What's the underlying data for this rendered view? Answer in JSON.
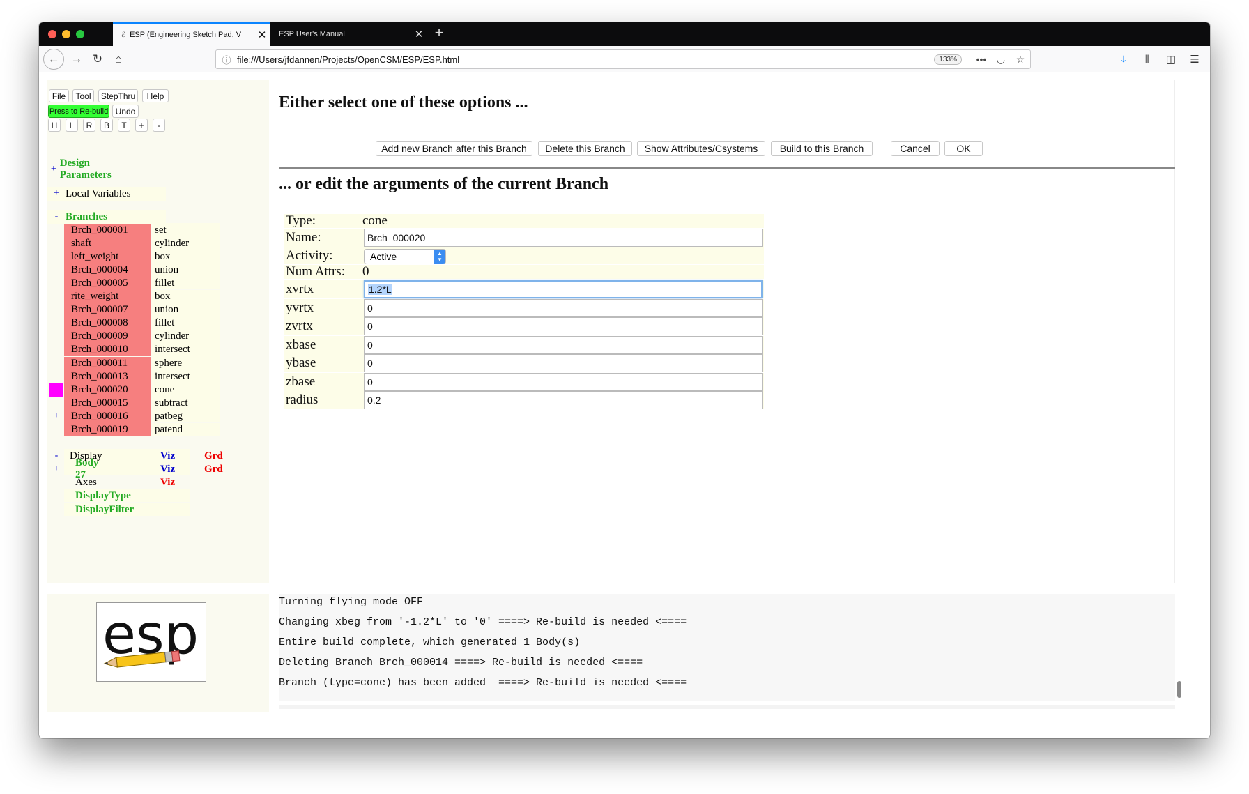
{
  "browser": {
    "tabs": [
      {
        "label": "ESP (Engineering Sketch Pad, V",
        "icon": "esp"
      },
      {
        "label": "ESP User's Manual"
      }
    ],
    "url": "file:///Users/jfdannen/Projects/OpenCSM/ESP/ESP.html",
    "zoom": "133%",
    "page_actions": "•••"
  },
  "menu": {
    "file": "File",
    "tool": "Tool",
    "stepthru": "StepThru",
    "help": "Help",
    "rebuild": "Press to Re-build",
    "undo": "Undo",
    "views": [
      "H",
      "L",
      "R",
      "B",
      "T",
      "+",
      "-"
    ]
  },
  "tree": {
    "design_params": {
      "toggle": "+",
      "label": "Design Parameters"
    },
    "local_vars": {
      "toggle": "+",
      "label": "Local Variables"
    },
    "branches_head": {
      "toggle": "-",
      "label": "Branches"
    },
    "branches": [
      {
        "mark": "",
        "name": "Brch_000001",
        "type": "set"
      },
      {
        "mark": "",
        "name": "shaft",
        "type": "cylinder"
      },
      {
        "mark": "",
        "name": "left_weight",
        "type": "box"
      },
      {
        "mark": "",
        "name": "Brch_000004",
        "type": "union"
      },
      {
        "mark": "",
        "name": "Brch_000005",
        "type": "fillet"
      },
      {
        "mark": "",
        "name": "rite_weight",
        "type": "box"
      },
      {
        "mark": "",
        "name": "Brch_000007",
        "type": "union"
      },
      {
        "mark": "",
        "name": "Brch_000008",
        "type": "fillet"
      },
      {
        "mark": "",
        "name": "Brch_000009",
        "type": "cylinder"
      },
      {
        "mark": "",
        "name": "Brch_000010",
        "type": "intersect"
      },
      {
        "mark": "",
        "name": "Brch_000011",
        "type": "sphere"
      },
      {
        "mark": "",
        "name": "Brch_000013",
        "type": "intersect"
      },
      {
        "mark": "current",
        "name": "Brch_000020",
        "type": "cone"
      },
      {
        "mark": "",
        "name": "Brch_000015",
        "type": "subtract"
      },
      {
        "mark": "+",
        "name": "Brch_000016",
        "type": "patbeg"
      },
      {
        "mark": "",
        "name": "Brch_000019",
        "type": "patend"
      }
    ],
    "display": {
      "toggle": "-",
      "label": "Display",
      "viz": "Viz",
      "grd": "Grd"
    },
    "body": {
      "toggle": "+",
      "label": "Body 27",
      "viz": "Viz",
      "grd": "Grd"
    },
    "axes": {
      "label": "Axes",
      "viz": "Viz"
    },
    "display_type": "DisplayType",
    "display_filter": "DisplayFilter",
    "colors": {
      "branch": "#f67f7f",
      "current": "#ff00ff",
      "green": "#22aa22"
    }
  },
  "main": {
    "heading1": "Either select one of these options ...",
    "buttons": {
      "add": "Add new Branch after this Branch",
      "delete": "Delete this Branch",
      "show": "Show Attributes/Csystems",
      "build": "Build to this Branch",
      "cancel": "Cancel",
      "ok": "OK"
    },
    "heading2": "... or edit the arguments of the current Branch",
    "form": {
      "type_label": "Type:",
      "type_value": "cone",
      "name_label": "Name:",
      "name_value": "Brch_000020",
      "activity_label": "Activity:",
      "activity_value": "Active",
      "numattrs_label": "Num Attrs:",
      "numattrs_value": "0",
      "args": [
        {
          "label": "xvrtx",
          "value": "1.2*L"
        },
        {
          "label": "yvrtx",
          "value": "0"
        },
        {
          "label": "zvrtx",
          "value": "0"
        },
        {
          "label": "xbase",
          "value": "0"
        },
        {
          "label": "ybase",
          "value": "0"
        },
        {
          "label": "zbase",
          "value": "0"
        },
        {
          "label": "radius",
          "value": "0.2"
        }
      ]
    }
  },
  "log": [
    "Turning flying mode OFF",
    "Changing xbeg from '-1.2*L' to '0' ====> Re-build is needed <====",
    "Entire build complete, which generated 1 Body(s)",
    "Deleting Branch Brch_000014 ====> Re-build is needed <====",
    "Branch (type=cone) has been added  ====> Re-build is needed <===="
  ],
  "logo": {
    "text": "esp"
  }
}
